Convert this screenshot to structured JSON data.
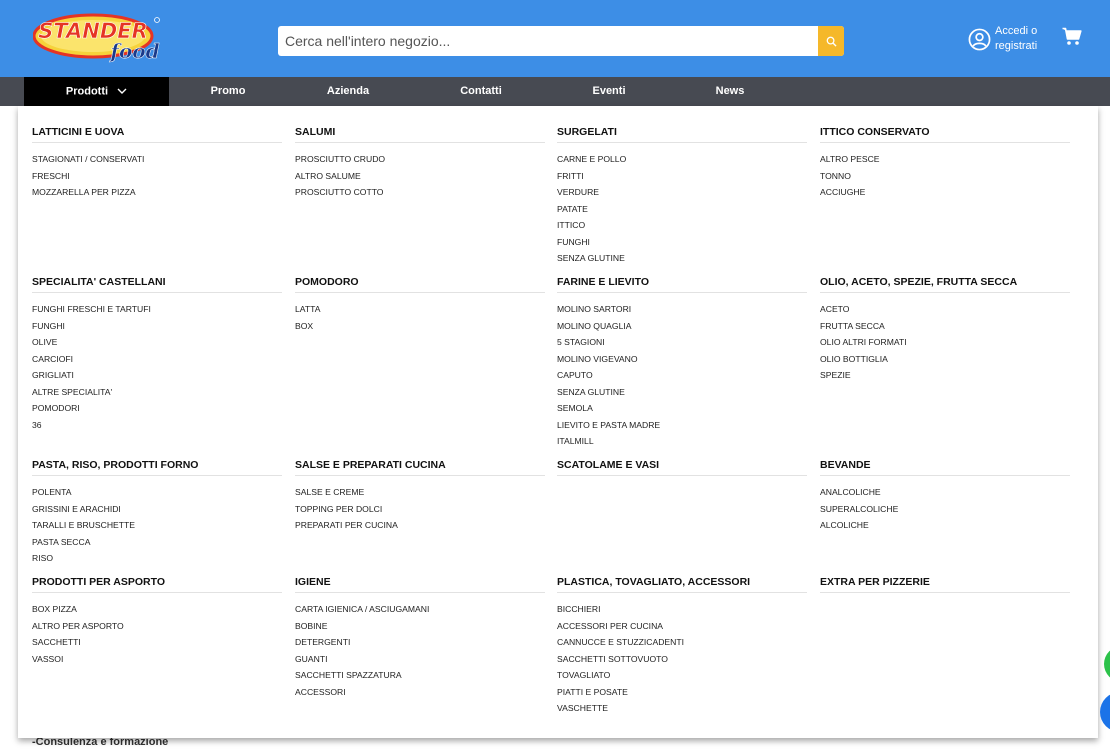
{
  "header": {
    "logo_text_top": "STANDER",
    "logo_text_bottom": "food",
    "search_placeholder": "Cerca nell'intero negozio...",
    "account_line1": "Accedi o",
    "account_line2": "registrati",
    "colors": {
      "header_bg": "#3d8ee6",
      "search_button": "#f5b82a",
      "nav_bg": "#474a52"
    }
  },
  "nav": {
    "items": [
      {
        "label": "Prodotti",
        "active": true
      },
      {
        "label": "Promo"
      },
      {
        "label": "Azienda"
      },
      {
        "label": "Contatti"
      },
      {
        "label": "Eventi"
      },
      {
        "label": "News"
      }
    ]
  },
  "menu": {
    "rows": [
      [
        {
          "title": "LATTICINI E UOVA",
          "items": [
            "STAGIONATI / CONSERVATI",
            "FRESCHI",
            "MOZZARELLA PER PIZZA"
          ]
        },
        {
          "title": "SALUMI",
          "items": [
            "PROSCIUTTO CRUDO",
            "ALTRO SALUME",
            "PROSCIUTTO COTTO"
          ]
        },
        {
          "title": "SURGELATI",
          "items": [
            "CARNE E POLLO",
            "FRITTI",
            "VERDURE",
            "PATATE",
            "ITTICO",
            "FUNGHI",
            "SENZA GLUTINE"
          ]
        },
        {
          "title": "ITTICO CONSERVATO",
          "items": [
            "ALTRO PESCE",
            "TONNO",
            "ACCIUGHE"
          ]
        }
      ],
      [
        {
          "title": "SPECIALITA' CASTELLANI",
          "items": [
            "FUNGHI FRESCHI E TARTUFI",
            "FUNGHI",
            "OLIVE",
            "CARCIOFI",
            "GRIGLIATI",
            "ALTRE SPECIALITA'",
            "POMODORI",
            "36"
          ]
        },
        {
          "title": "POMODORO",
          "items": [
            "LATTA",
            "BOX"
          ]
        },
        {
          "title": "FARINE E LIEVITO",
          "items": [
            "MOLINO SARTORI",
            "MOLINO QUAGLIA",
            "5 STAGIONI",
            "MOLINO VIGEVANO",
            "CAPUTO",
            "SENZA GLUTINE",
            "SEMOLA",
            "LIEVITO E PASTA MADRE",
            "ITALMILL"
          ]
        },
        {
          "title": "OLIO, ACETO, SPEZIE, FRUTTA SECCA",
          "items": [
            "ACETO",
            "FRUTTA SECCA",
            "OLIO ALTRI FORMATI",
            "OLIO BOTTIGLIA",
            "SPEZIE"
          ]
        }
      ],
      [
        {
          "title": "PASTA, RISO, PRODOTTI FORNO",
          "items": [
            "POLENTA",
            "GRISSINI E ARACHIDI",
            "TARALLI E BRUSCHETTE",
            "PASTA SECCA",
            "RISO"
          ]
        },
        {
          "title": "SALSE E PREPARATI CUCINA",
          "items": [
            "SALSE E CREME",
            "TOPPING PER DOLCI",
            "PREPARATI PER CUCINA"
          ]
        },
        {
          "title": "SCATOLAME E VASI",
          "items": []
        },
        {
          "title": "BEVANDE",
          "items": [
            "ANALCOLICHE",
            "SUPERALCOLICHE",
            "ALCOLICHE"
          ]
        }
      ],
      [
        {
          "title": "PRODOTTI PER ASPORTO",
          "items": [
            "BOX PIZZA",
            "ALTRO PER ASPORTO",
            "SACCHETTI",
            "VASSOI"
          ]
        },
        {
          "title": "IGIENE",
          "items": [
            "CARTA IGIENICA / ASCIUGAMANI",
            "BOBINE",
            "DETERGENTI",
            "GUANTI",
            "SACCHETTI SPAZZATURA",
            "ACCESSORI"
          ]
        },
        {
          "title": "PLASTICA, TOVAGLIATO, ACCESSORI",
          "items": [
            "BICCHIERI",
            "ACCESSORI PER CUCINA",
            "CANNUCCE E STUZZICADENTI",
            "SACCHETTI SOTTOVUOTO",
            "TOVAGLIATO",
            "PIATTI E POSATE",
            "VASCHETTE"
          ]
        },
        {
          "title": "EXTRA PER PIZZERIE",
          "items": []
        }
      ]
    ]
  },
  "background_text": "-Consulenza e formazione"
}
